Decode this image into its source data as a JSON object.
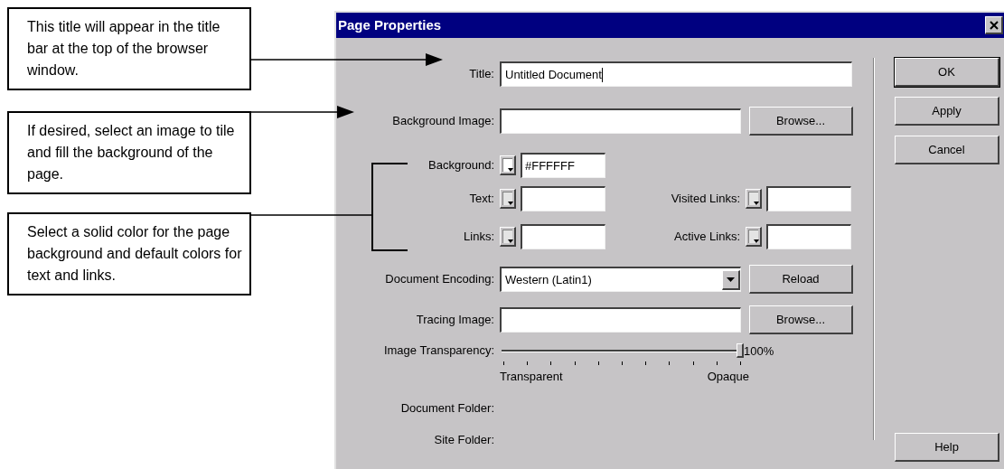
{
  "callouts": [
    {
      "text": "This title will appear in the title bar at the top of the browser window."
    },
    {
      "text": "If desired, select an image to tile and fill the background of the page."
    },
    {
      "text": "Select a solid color for the page background and default colors for text and links."
    }
  ],
  "dialog": {
    "title": "Page Properties",
    "rows": [
      {
        "kind": "text",
        "label": "Title:",
        "value": "Untitled Document",
        "focused": true
      },
      {
        "kind": "file",
        "label": "Background Image:",
        "button": "Browse..."
      },
      {
        "kind": "colors",
        "items": [
          {
            "label": "Background:",
            "value": "#FFFFFF"
          }
        ]
      },
      {
        "kind": "colors",
        "items": [
          {
            "label": "Text:"
          },
          {
            "label": "Visited Links:"
          }
        ]
      },
      {
        "kind": "colors",
        "items": [
          {
            "label": "Links:"
          },
          {
            "label": "Active Links:"
          }
        ]
      },
      {
        "kind": "select",
        "label": "Document Encoding:",
        "value": "Western (Latin1)",
        "button": "Reload"
      },
      {
        "kind": "file",
        "label": "Tracing Image:",
        "button": "Browse..."
      },
      {
        "kind": "slider",
        "label": "Image Transparency:",
        "level": 1,
        "reading": "100%",
        "min_label": "Transparent",
        "max_label": "Opaque"
      },
      {
        "kind": "info",
        "label": "Document Folder:"
      },
      {
        "kind": "info",
        "label": "Site Folder:"
      }
    ],
    "buttons": [
      {
        "label": "OK",
        "default": true
      },
      {
        "label": "Apply",
        "default": false
      },
      {
        "label": "Cancel",
        "default": false
      }
    ],
    "help_button": {
      "label": "Help"
    }
  }
}
